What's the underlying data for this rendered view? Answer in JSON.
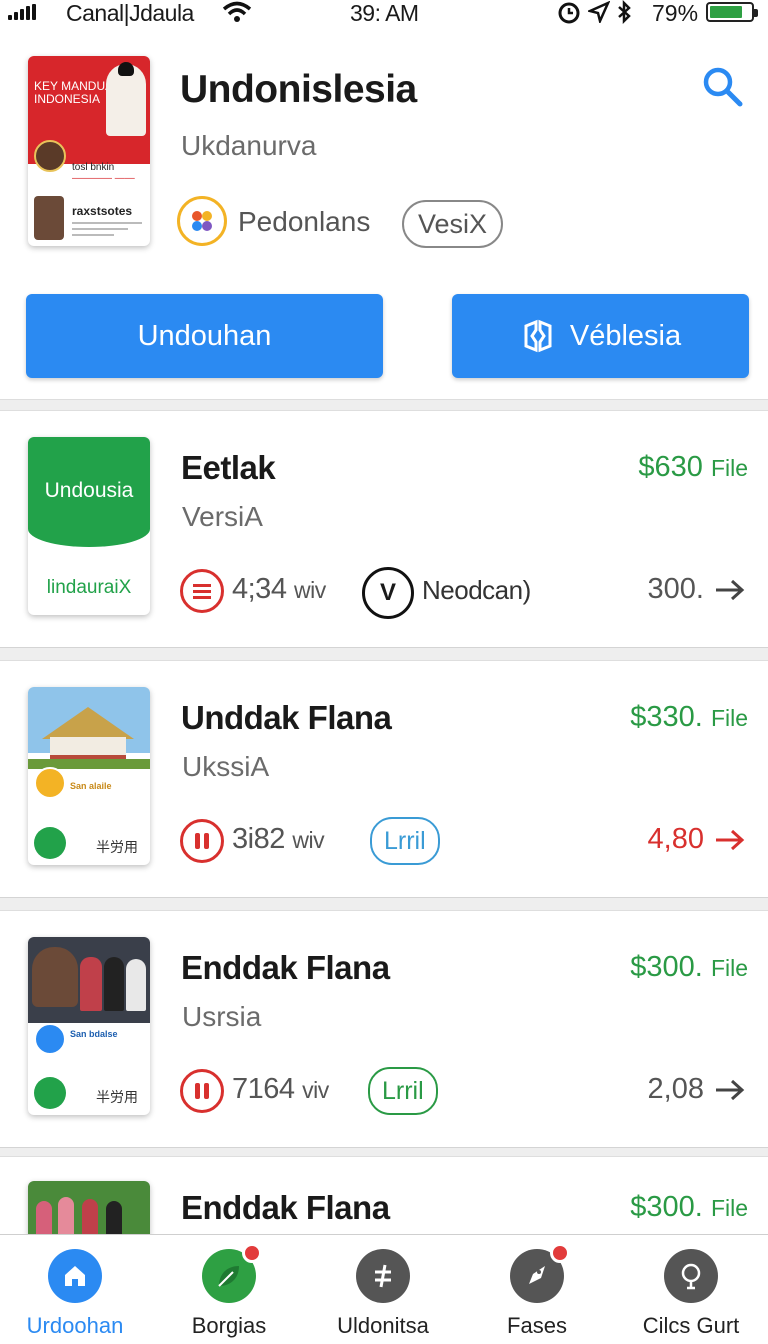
{
  "status": {
    "carrier": "Canal|Jdaula",
    "time": "39: AM",
    "battery": "79%",
    "battery_level": 0.79
  },
  "app": {
    "cover_text": "KEY MANDUAI INDONESIA",
    "cover_small": "tosl bnkin",
    "cover_small2": "raxstsotes",
    "title": "Undonislesia",
    "subtitle": "Ukdanurva",
    "developer": "Pedonlans",
    "version": "VesiX",
    "download_label": "Undouhan",
    "open_label": "Véblesia"
  },
  "items": [
    {
      "thumb_top": "Undousia",
      "thumb_bottom": "lindauraiX",
      "title": "Eetlak",
      "subtitle": "VersiA",
      "price": "$630",
      "price_unit": "File",
      "size": "4;34",
      "size_unit": "wiv",
      "badge_label": "Neodcan)",
      "count": "300.",
      "count_color": "gray"
    },
    {
      "thumb_label": "San alaile",
      "thumb_foot": "半労用",
      "title": "Unddak Flana",
      "subtitle": "UkssiA",
      "price": "$330.",
      "price_unit": "File",
      "size": "3i82",
      "size_unit": "wiv",
      "tag": "Lrril",
      "tag_color": "#3a9bd5",
      "count": "4,80",
      "count_color": "red"
    },
    {
      "thumb_label": "San bdalse",
      "thumb_foot": "半労用",
      "title": "Enddak Flana",
      "subtitle": "Usrsia",
      "price": "$300.",
      "price_unit": "File",
      "size": "7164",
      "size_unit": "viv",
      "tag": "Lrril",
      "tag_color": "#2a9a45",
      "count": "2,08",
      "count_color": "gray"
    },
    {
      "title": "Enddak Flana",
      "price": "$300.",
      "price_unit": "File"
    }
  ],
  "tabs": [
    {
      "label": "Urdoohan",
      "active": true
    },
    {
      "label": "Borgias"
    },
    {
      "label": "Uldonitsa"
    },
    {
      "label": "Fases"
    },
    {
      "label": "Cilcs Gurt"
    }
  ],
  "colors": {
    "accent": "#2b8af2",
    "price_green": "#2a9a45",
    "alert_red": "#d8302e"
  }
}
